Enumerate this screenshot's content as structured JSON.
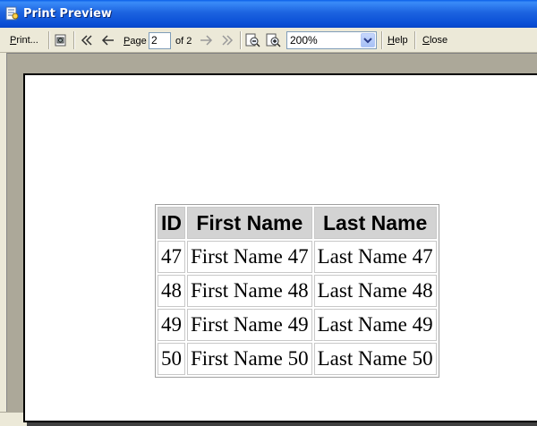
{
  "window": {
    "title": "Print Preview"
  },
  "toolbar": {
    "print_label": "Print...",
    "page_label": "Page",
    "page_value": "2",
    "of_label": "of 2",
    "zoom_value": "200%",
    "help_label": "Help",
    "close_label": "Close"
  },
  "table": {
    "headers": [
      "ID",
      "First Name",
      "Last Name"
    ],
    "rows": [
      [
        "47",
        "First Name 47",
        "Last Name 47"
      ],
      [
        "48",
        "First Name 48",
        "Last Name 48"
      ],
      [
        "49",
        "First Name 49",
        "Last Name 49"
      ],
      [
        "50",
        "First Name 50",
        "Last Name 50"
      ]
    ]
  },
  "colors": {
    "titlebar": "#0a4fd6",
    "toolbar_bg": "#ece9d8",
    "preview_bg": "#aca899",
    "header_bg": "#d3d3d3"
  }
}
